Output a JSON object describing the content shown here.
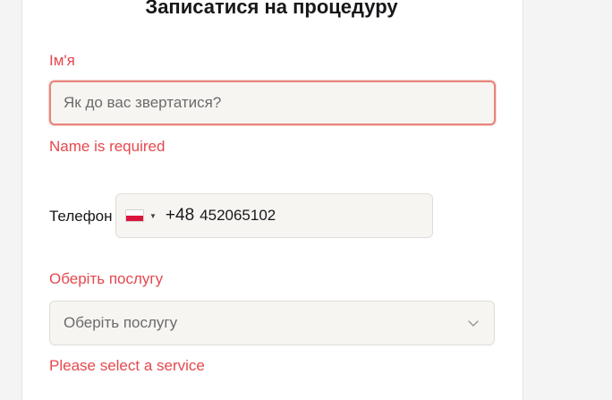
{
  "form": {
    "title": "Записатися на процедуру",
    "name": {
      "label": "Ім'я",
      "placeholder": "Як до вас звертатися?",
      "value": "",
      "error": "Name is required"
    },
    "phone": {
      "label": "Телефон",
      "country_flag": "poland-flag-icon",
      "dial_code": "+48",
      "value": "452065102"
    },
    "service": {
      "label": "Оберіть послугу",
      "placeholder": "Оберіть послугу",
      "error": "Please select a service"
    }
  },
  "colors": {
    "error": "#e5484d",
    "input_bg": "#f7f5f2",
    "focus_border": "#e8857a",
    "text": "#18181b",
    "placeholder": "#6b6b6b"
  }
}
